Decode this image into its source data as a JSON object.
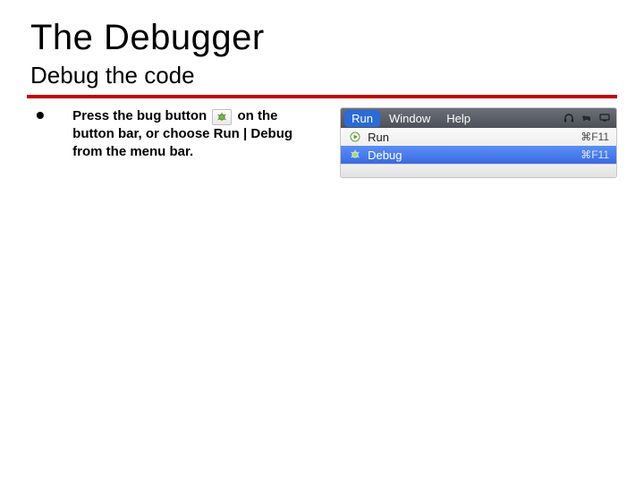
{
  "title": "The Debugger",
  "subtitle": "Debug the code",
  "bullet": "•",
  "body": {
    "line1a": "Press the bug button ",
    "line1b": " on the button bar, or choose Run | Debug from the menu bar."
  },
  "menubar": {
    "items": [
      "Run",
      "Window",
      "Help"
    ],
    "selected_index": 0
  },
  "dropdown": {
    "items": [
      {
        "icon": "run-icon",
        "label": "Run",
        "shortcut": "⌘F11",
        "selected": false
      },
      {
        "icon": "debug-icon",
        "label": "Debug",
        "shortcut": "⌘F11",
        "selected": true
      }
    ]
  }
}
